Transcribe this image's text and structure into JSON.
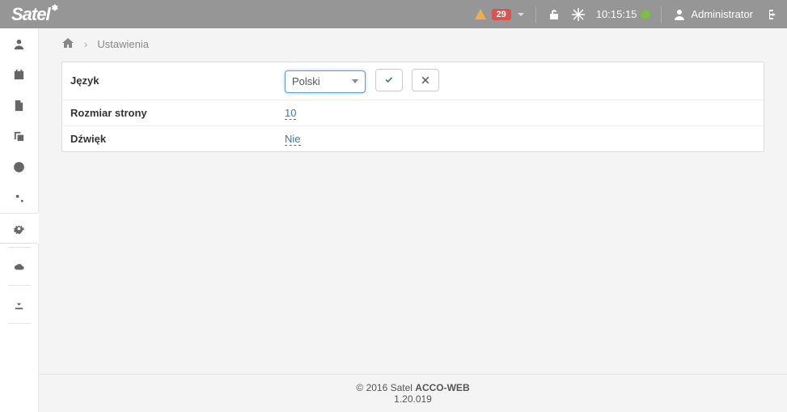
{
  "header": {
    "logo_text": "Satel",
    "logo_symbol": "✽",
    "alert_count": "29",
    "clock": "10:15:15",
    "username": "Administrator"
  },
  "breadcrumb": {
    "page": "Ustawienia"
  },
  "settings": {
    "rows": [
      {
        "label": "Język",
        "value": "Polski",
        "editing": true
      },
      {
        "label": "Rozmiar strony",
        "value": "10",
        "editing": false
      },
      {
        "label": "Dźwięk",
        "value": "Nie",
        "editing": false
      }
    ]
  },
  "footer": {
    "copyright_prefix": "© 2016 Satel ",
    "product": "ACCO-WEB",
    "version": "1.20.019"
  }
}
